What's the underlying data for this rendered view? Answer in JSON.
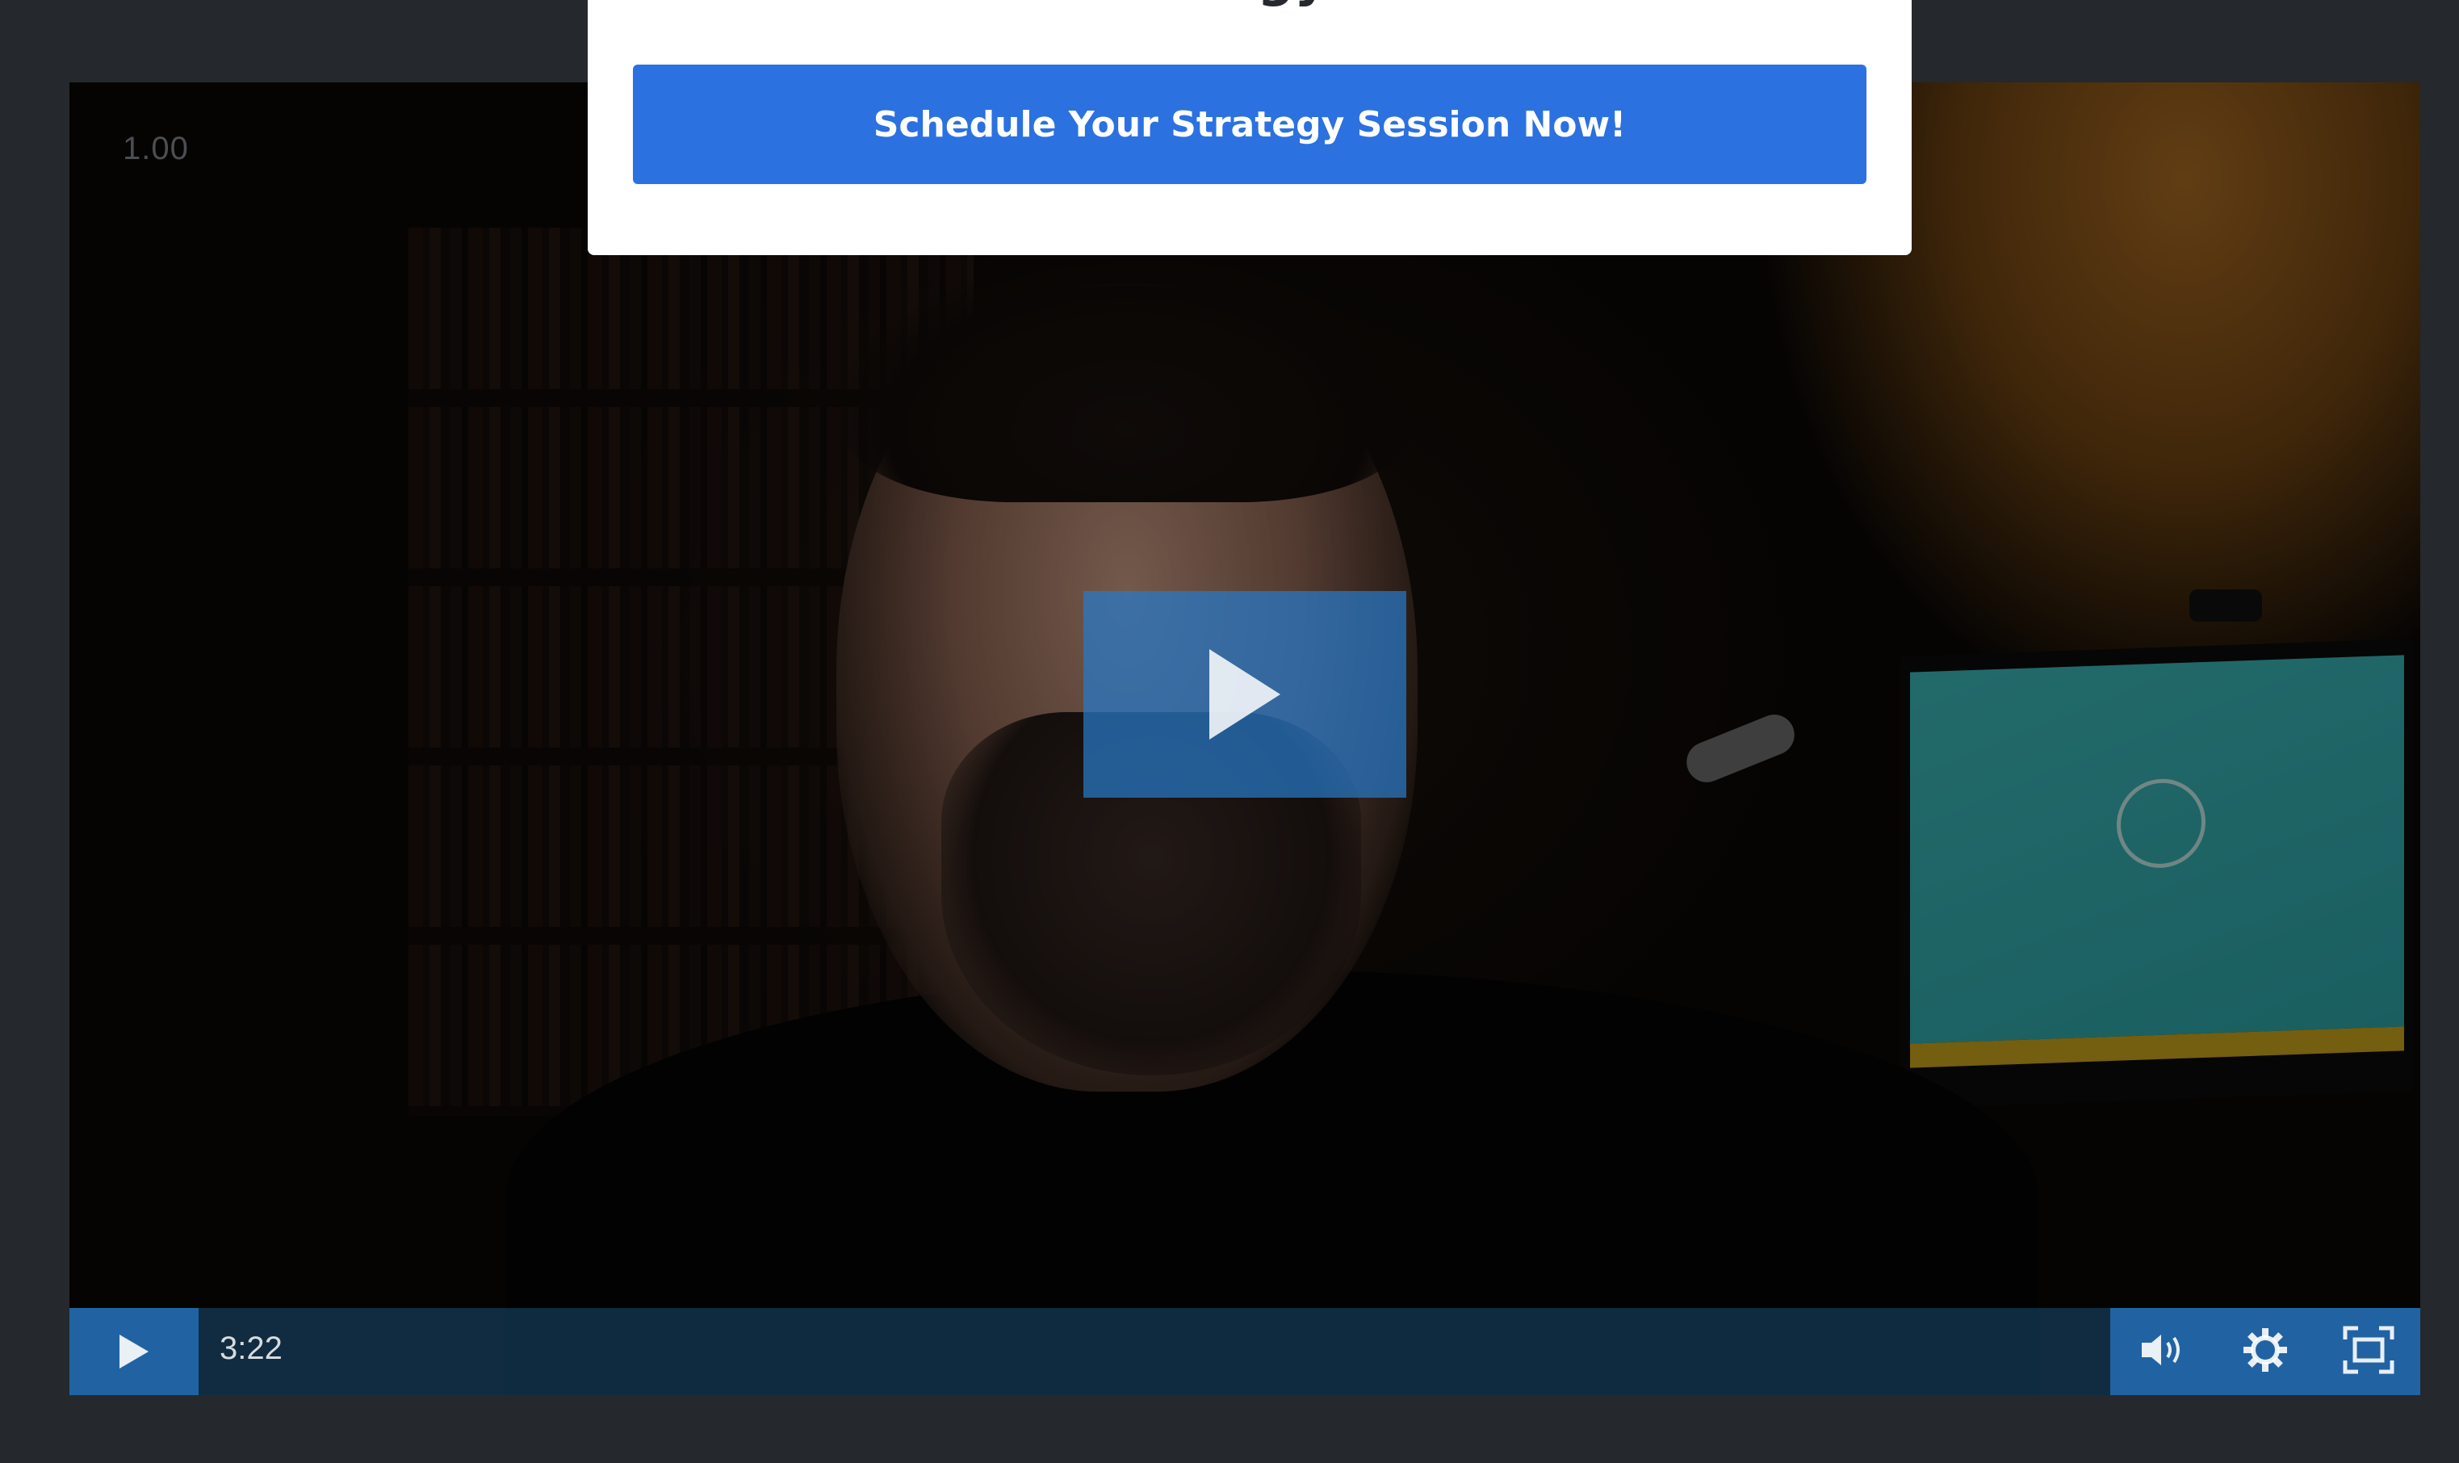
{
  "popup": {
    "title": "Free Strategy Session",
    "button_label": "Schedule Your Strategy Session Now!"
  },
  "player": {
    "speed_label": "1.00",
    "time_display": "3:22",
    "accent_color": "#2b71e0"
  },
  "icons": {
    "big_play": "play-icon",
    "play": "play-icon",
    "volume": "volume-icon",
    "settings": "gear-icon",
    "fullscreen": "fullscreen-icon"
  }
}
